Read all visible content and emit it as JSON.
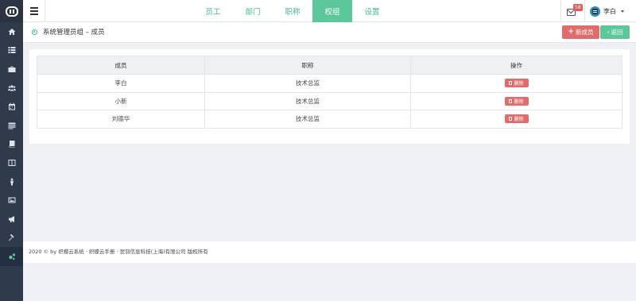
{
  "sidebar": {
    "items": [
      {
        "name": "home-icon"
      },
      {
        "name": "list-icon"
      },
      {
        "name": "briefcase-icon"
      },
      {
        "name": "users-icon"
      },
      {
        "name": "calendar-icon"
      },
      {
        "name": "news-icon"
      },
      {
        "name": "book-icon"
      },
      {
        "name": "columns-icon"
      },
      {
        "name": "person-icon"
      },
      {
        "name": "image-icon"
      },
      {
        "name": "megaphone-icon"
      },
      {
        "name": "gavel-icon"
      },
      {
        "name": "cogs-icon"
      }
    ],
    "active_index": 12,
    "active_color": "#5cc79a"
  },
  "topbar": {
    "tabs": [
      "员工",
      "部门",
      "职称",
      "权组",
      "设置"
    ],
    "active_tab": "权组",
    "mail_count": "58",
    "user_name": "李白"
  },
  "subheader": {
    "breadcrumb": "系统管理员组 – 成员",
    "new_member_label": "新成员",
    "back_label": "返回"
  },
  "table": {
    "headers": [
      "成员",
      "职称",
      "操作"
    ],
    "rows": [
      {
        "member": "李白",
        "title": "技术总监",
        "action": "删除"
      },
      {
        "member": "小新",
        "title": "技术总监",
        "action": "删除"
      },
      {
        "member": "刘德华",
        "title": "技术总监",
        "action": "删除"
      }
    ]
  },
  "footer": {
    "text": "2020 © by 织蝶云系统 · 织蝶云手册 · 翌羽信息科技(上海)有限公司 版权所有"
  },
  "colors": {
    "accent": "#5cc79a",
    "danger": "#e26c6c",
    "sidebar": "#2f3a4a"
  }
}
